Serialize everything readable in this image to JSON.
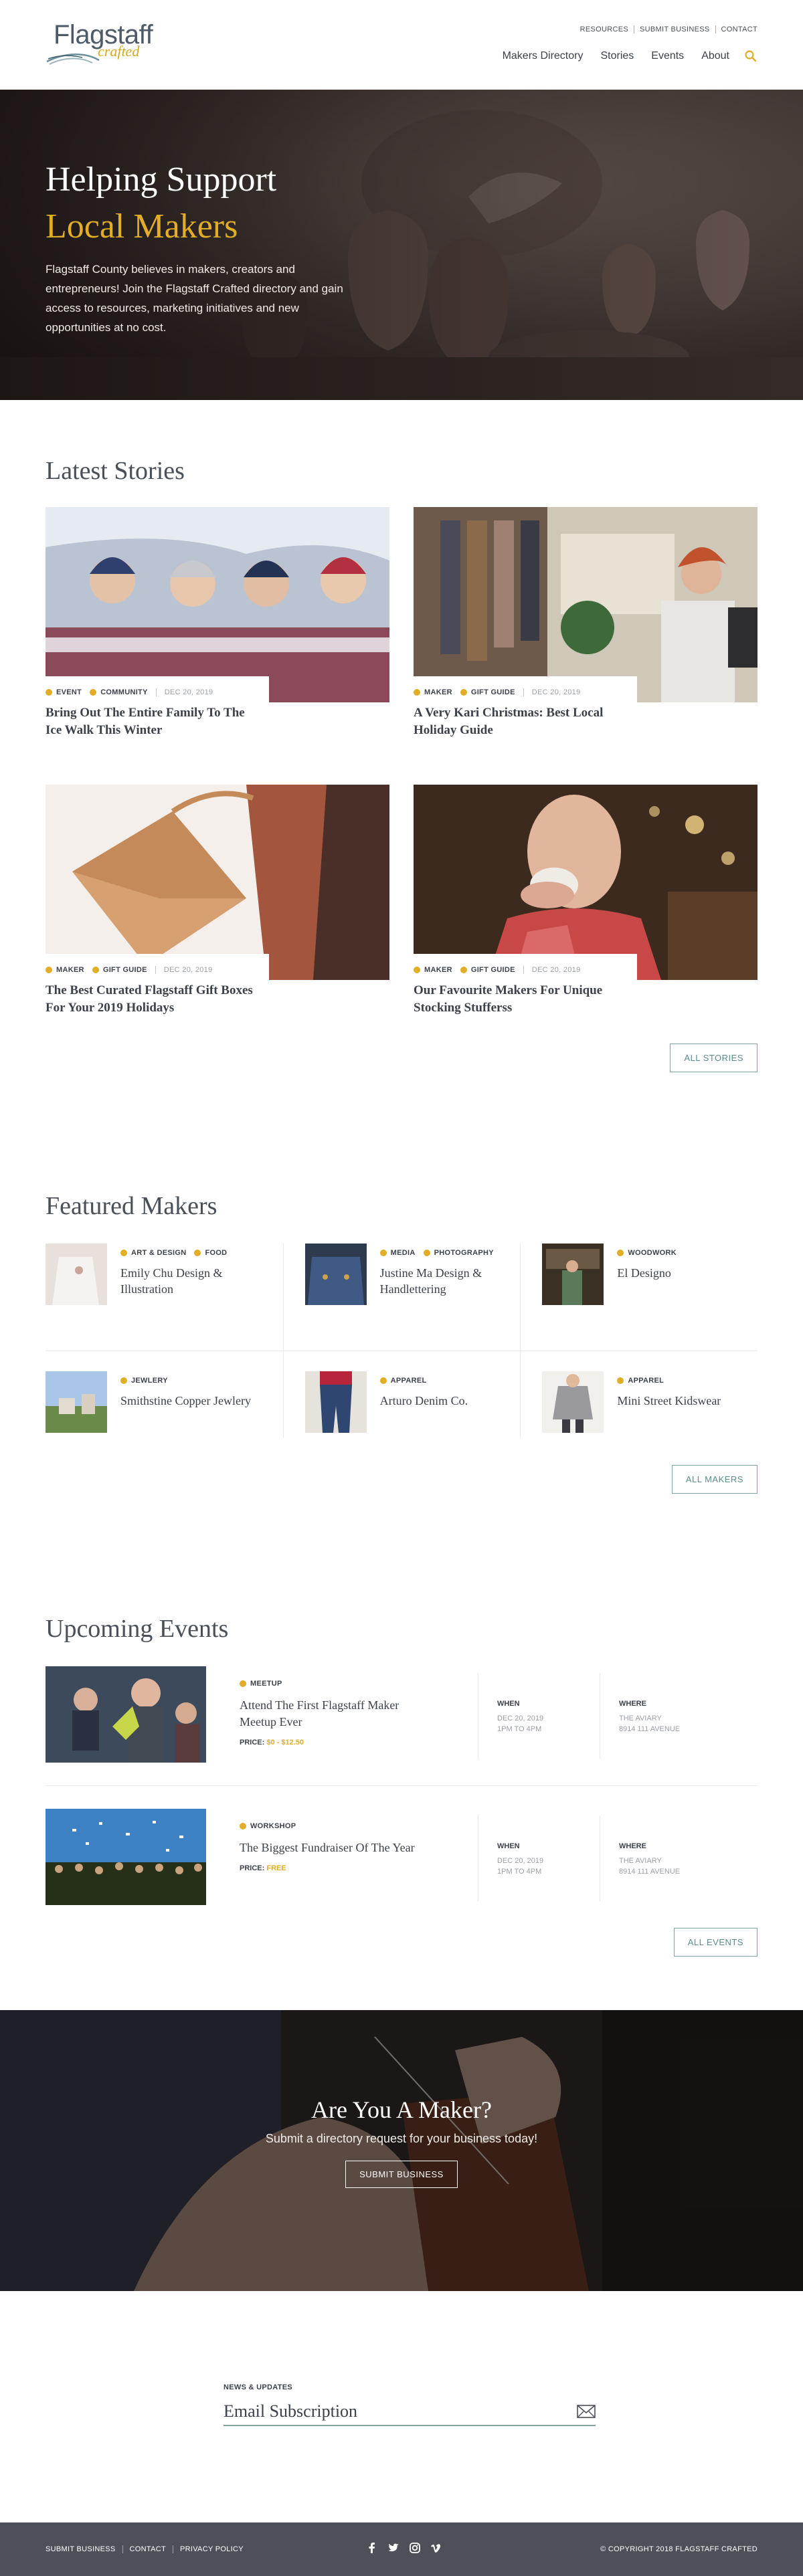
{
  "header": {
    "logo_main": "Flagstaff",
    "logo_sub": "crafted",
    "util_nav": [
      "RESOURCES",
      "SUBMIT BUSINESS",
      "CONTACT"
    ],
    "main_nav": [
      "Makers Directory",
      "Stories",
      "Events",
      "About"
    ]
  },
  "hero": {
    "title_line1": "Helping Support",
    "title_line2": "Local Makers",
    "body": "Flagstaff County believes in makers, creators and entrepreneurs! Join the Flagstaff Crafted directory and gain access to resources, marketing initiatives and new opportunities at no cost."
  },
  "latest": {
    "title": "Latest Stories",
    "stories": [
      {
        "tags": [
          "EVENT",
          "COMMUNITY"
        ],
        "date": "DEC 20, 2019",
        "title": "Bring Out The Entire Family To The Ice Walk This Winter"
      },
      {
        "tags": [
          "MAKER",
          "GIFT GUIDE"
        ],
        "date": "DEC 20, 2019",
        "title": "A Very Kari Christmas: Best Local Holiday Guide"
      },
      {
        "tags": [
          "MAKER",
          "GIFT GUIDE"
        ],
        "date": "DEC 20, 2019",
        "title": "The Best Curated Flagstaff Gift Boxes For Your 2019 Holidays"
      },
      {
        "tags": [
          "MAKER",
          "GIFT GUIDE"
        ],
        "date": "DEC 20, 2019",
        "title": "Our Favourite Makers For Unique Stocking Stufferss"
      }
    ],
    "button": "ALL STORIES"
  },
  "featured": {
    "title": "Featured Makers",
    "makers": [
      {
        "tags": [
          "ART & DESIGN",
          "FOOD"
        ],
        "name": "Emily Chu Design & Illustration"
      },
      {
        "tags": [
          "MEDIA",
          "PHOTOGRAPHY"
        ],
        "name": "Justine Ma Design & Handlettering"
      },
      {
        "tags": [
          "WOODWORK"
        ],
        "name": "El Designo"
      },
      {
        "tags": [
          "JEWLERY"
        ],
        "name": "Smithstine Copper Jewlery"
      },
      {
        "tags": [
          "APPAREL"
        ],
        "name": "Arturo Denim Co."
      },
      {
        "tags": [
          "APPAREL"
        ],
        "name": "Mini Street Kidswear"
      }
    ],
    "button": "ALL MAKERS"
  },
  "events": {
    "title": "Upcoming Events",
    "items": [
      {
        "tag": "MEETUP",
        "title": "Attend The First Flagstaff Maker Meetup Ever",
        "price_label": "PRICE:",
        "price": "$0 - $12.50",
        "when_label": "WHEN",
        "when_date": "DEC 20, 2019",
        "when_time": "1PM TO 4PM",
        "where_label": "WHERE",
        "where_name": "THE AVIARY",
        "where_addr": "8914 111 AVENUE"
      },
      {
        "tag": "WORKSHOP",
        "title": "The Biggest Fundraiser Of The Year",
        "price_label": "PRICE:",
        "price": "FREE",
        "when_label": "WHEN",
        "when_date": "DEC 20, 2019",
        "when_time": "1PM TO 4PM",
        "where_label": "WHERE",
        "where_name": "THE AVIARY",
        "where_addr": "8914 111 AVENUE"
      }
    ],
    "button": "ALL EVENTS"
  },
  "cta": {
    "title": "Are You A Maker?",
    "body": "Submit a directory request for your business today!",
    "button": "SUBMIT BUSINESS"
  },
  "newsletter": {
    "label": "NEWS & UPDATES",
    "placeholder": "Email Subscription"
  },
  "footer": {
    "links": [
      "SUBMIT BUSINESS",
      "CONTACT",
      "PRIVACY POLICY"
    ],
    "social": [
      "facebook-icon",
      "twitter-icon",
      "instagram-icon",
      "vimeo-icon"
    ],
    "copyright": "© COPYRIGHT 2018 FLAGSTAFF CRAFTED"
  },
  "colors": {
    "accent": "#e2ae27",
    "teal": "#5c8b8e",
    "text": "#3c414a",
    "footer": "#4d5058"
  }
}
